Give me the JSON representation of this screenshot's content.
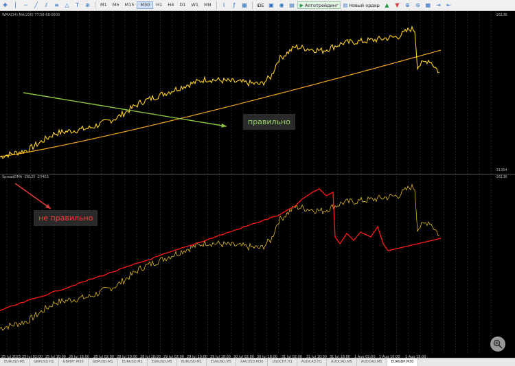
{
  "toolbar": {
    "timeframes": [
      "M1",
      "M5",
      "M15",
      "M30",
      "H1",
      "H4",
      "D1",
      "W1",
      "MN"
    ],
    "active_timeframe": "M30",
    "ide_label": "IDE",
    "algo_label": "Алготрейдинг",
    "order_label": "Новый ордер"
  },
  "chart": {
    "top_pane_label": "WMA(14) MA(200) 77:58 68:0000",
    "bottom_pane_label": "SpreadDMA -28125 -23403",
    "top_scale_top": "-26136",
    "top_scale_bottom": "-31354",
    "bottom_scale_top": "-26136",
    "x_labels": [
      "25 Jul 2025",
      "25 Jul 02:00",
      "25 Jul 10:00",
      "26 Jul 18:00",
      "28 Jul 02:00",
      "28 Jul 10:00",
      "28 Jul 18:00",
      "29 Jul 02:00",
      "29 Jul 10:00",
      "29 Jul 18:00",
      "30 Jul 02:00",
      "30 Jul 18:00",
      "31 Jul 02:00",
      "31 Jul 10:00",
      "31 Jul 18:00",
      "1 Aug 02:00",
      "1 Aug 10:00",
      "1 Aug 18:00"
    ],
    "note_correct": "правильно",
    "note_wrong": "не правильно",
    "colors": {
      "price_line": "#ffd21f",
      "ma_line": "#f5a623",
      "spread_line": "#ff1a1a",
      "green_arrow": "#8ac640",
      "red_arrow": "#e33c3c"
    }
  },
  "tabs": [
    "EURUSD,M5",
    "GBPUSD,H1",
    "GBPJPY,M30",
    "GBPUSD,M1",
    "EURUSD,M1",
    "EURUSD,M5",
    "EURUSD,M1",
    "EURUSD,M5",
    "XAUUSD,M30",
    "USDCHF,H1",
    "AUDCAD,H1",
    "AUDCAD,M5",
    "AUDCAD,M5",
    "EURGBP,M30"
  ],
  "active_tab": "EURGBP,M30"
}
